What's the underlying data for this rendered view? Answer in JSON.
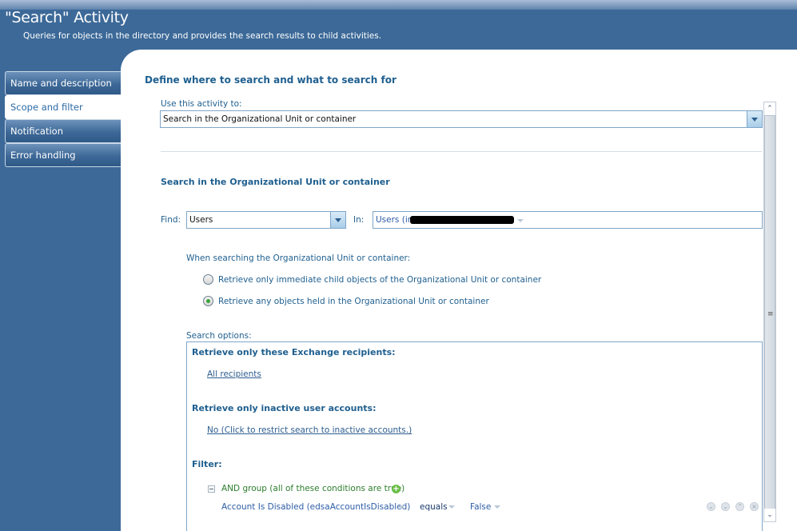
{
  "header": {
    "title": "\"Search\" Activity",
    "subtitle": "Queries for objects in the directory and provides the search results to child activities."
  },
  "sidebar": {
    "items": [
      {
        "label": "Name and description",
        "active": false
      },
      {
        "label": "Scope and filter",
        "active": true
      },
      {
        "label": "Notification",
        "active": false
      },
      {
        "label": "Error handling",
        "active": false
      }
    ]
  },
  "main": {
    "section_title": "Define where to search and what to search for",
    "use_activity_label": "Use this activity to:",
    "use_activity_value": "Search in the Organizational Unit or container",
    "sub_section_title": "Search in the Organizational Unit or container",
    "find_label": "Find:",
    "find_value": "Users",
    "in_label": "In:",
    "in_value": "Users (in",
    "searching_label": "When searching the Organizational Unit or container:",
    "radio_options": [
      {
        "label": "Retrieve only immediate child objects of the Organizational Unit or container",
        "checked": false
      },
      {
        "label": "Retrieve any objects held in the Organizational Unit or container",
        "checked": true
      }
    ],
    "search_options_label": "Search options:",
    "options": {
      "exchange_heading": "Retrieve only these Exchange recipients:",
      "exchange_link": "All recipients",
      "inactive_heading": "Retrieve only inactive user accounts:",
      "inactive_link": "No (Click to restrict search to inactive accounts.)",
      "filter_heading": "Filter:",
      "and_group": "AND group (all of these conditions are true)",
      "condition": {
        "property": "Account Is Disabled (edsaAccountIsDisabled)",
        "operator": "equals",
        "value": "False"
      }
    }
  },
  "colors": {
    "background": "#3c6998",
    "accent": "#1f5f8f",
    "green": "#2d7d2d"
  }
}
